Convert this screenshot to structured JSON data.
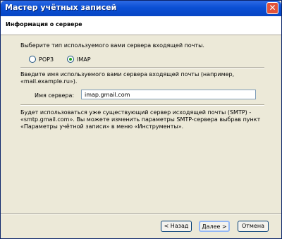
{
  "window": {
    "title": "Мастер учётных записей"
  },
  "header": {
    "title": "Информация о сервере"
  },
  "server_type": {
    "prompt": "Выберите тип используемого вами сервера входящей почты.",
    "options": [
      {
        "label": "POP3",
        "selected": false
      },
      {
        "label": "IMAP",
        "selected": true
      }
    ]
  },
  "incoming": {
    "prompt_line1": "Введите имя используемого вами сервера входящей почты (например,",
    "prompt_line2": "«mail.example.ru»).",
    "field_label": "Имя сервера:",
    "field_value": "imap.gmail.com"
  },
  "smtp_note": {
    "line1": "Будет использоваться уже существующий сервер исходящей почты (SMTP) -",
    "line2": "«smtp.gmail.com». Вы можете изменить параметры SMTP-сервера выбрав пункт",
    "line3": "«Параметры учётной записи» в меню «Инструменты»."
  },
  "buttons": {
    "back": "< Назад",
    "next": "Далее >",
    "cancel": "Отмена"
  }
}
